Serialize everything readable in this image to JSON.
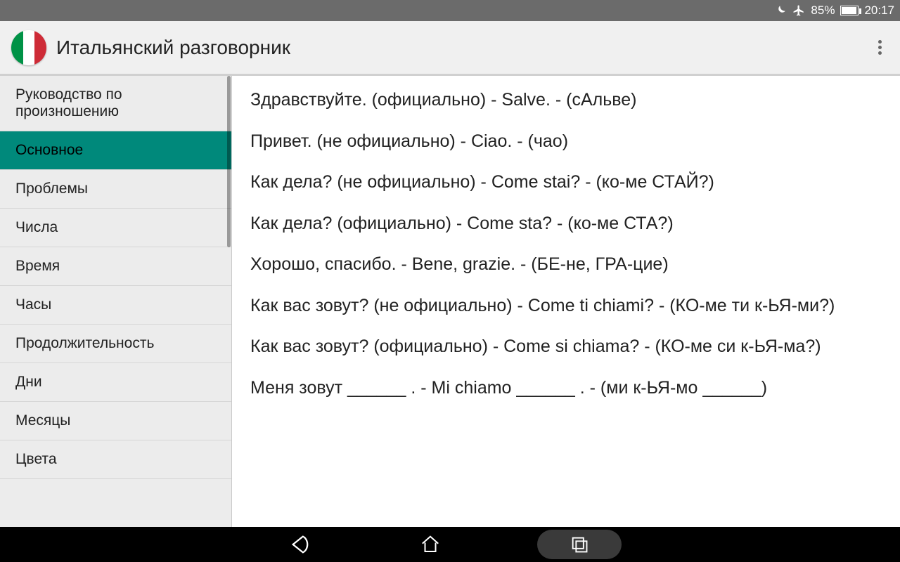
{
  "status": {
    "battery_pct": "85%",
    "time": "20:17"
  },
  "appbar": {
    "title": "Итальянский разговорник"
  },
  "sidebar": {
    "items": [
      {
        "label": "Руководство по произношению",
        "selected": false
      },
      {
        "label": "Основное",
        "selected": true
      },
      {
        "label": "Проблемы",
        "selected": false
      },
      {
        "label": "Числа",
        "selected": false
      },
      {
        "label": "Время",
        "selected": false
      },
      {
        "label": "Часы",
        "selected": false
      },
      {
        "label": "Продолжительность",
        "selected": false
      },
      {
        "label": "Дни",
        "selected": false
      },
      {
        "label": "Месяцы",
        "selected": false
      },
      {
        "label": "Цвета",
        "selected": false
      }
    ]
  },
  "content": {
    "phrases": [
      "Здравствуйте. (официально) - Salve. - (сАльве)",
      "Привет. (не официально) - Ciao. - (чао)",
      "Как дела? (не официально) - Come stai? - (ко-ме СТАЙ?)",
      "Как дела? (официально) - Come sta? - (ко-ме СТА?)",
      "Хорошо, спасибо. - Bene, grazie. - (БЕ-не, ГРА-цие)",
      "Как вас зовут? (не официально) - Come ti chiami? - (КО-ме ти к-ЬЯ-ми?)",
      "Как вас зовут? (официально) - Come si chiama? - (КО-ме си к-ЬЯ-ма?)",
      "Меня зовут ______ . - Mi chiamo ______ . - (ми к-ЬЯ-мо ______)"
    ]
  }
}
